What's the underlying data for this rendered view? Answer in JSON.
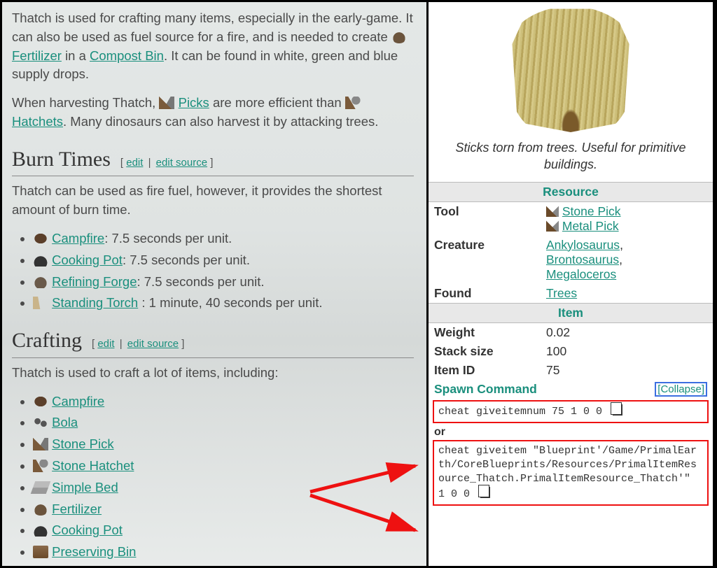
{
  "intro": {
    "p1a": "Thatch is used for crafting many items, especially in the early-game. It can also be used as fuel source for a fire, and is needed to create ",
    "fertilizer": "Fertilizer",
    "p1b": " in a ",
    "compost_bin": "Compost Bin",
    "p1c": ". It can be found in white, green and blue supply drops.",
    "p2a": "When harvesting Thatch, ",
    "picks": "Picks",
    "p2b": " are more efficient than ",
    "hatchets": "Hatchets",
    "p2c": ". Many dinosaurs can also harvest it by attacking trees."
  },
  "sections": {
    "burn": {
      "title": "Burn Times",
      "edit": "edit",
      "edit_source": "edit source",
      "intro": "Thatch can be used as fire fuel, however, it provides the shortest amount of burn time.",
      "items": [
        {
          "name": "Campfire",
          "tail": ": 7.5 seconds per unit."
        },
        {
          "name": "Cooking Pot",
          "tail": ": 7.5 seconds per unit."
        },
        {
          "name": "Refining Forge",
          "tail": ": 7.5 seconds per unit."
        },
        {
          "name": "Standing Torch",
          "tail": " : 1 minute, 40 seconds per unit."
        }
      ]
    },
    "craft": {
      "title": "Crafting",
      "edit": "edit",
      "edit_source": "edit source",
      "intro": "Thatch is used to craft a lot of items, including:",
      "items": [
        "Campfire",
        "Bola",
        "Stone Pick",
        "Stone Hatchet",
        "Simple Bed",
        "Fertilizer",
        "Cooking Pot",
        "Preserving Bin"
      ]
    }
  },
  "info": {
    "caption": "Sticks torn from trees. Useful for primitive buildings.",
    "resource_head": "Resource",
    "item_head": "Item",
    "rows": {
      "tool_k": "Tool",
      "tool_v1": "Stone Pick",
      "tool_v2": "Metal Pick",
      "creature_k": "Creature",
      "creature_v1": "Ankylosaurus",
      "creature_v2": "Brontosaurus",
      "creature_v3": "Megaloceros",
      "found_k": "Found",
      "found_v": "Trees",
      "weight_k": "Weight",
      "weight_v": "0.02",
      "stack_k": "Stack size",
      "stack_v": "100",
      "id_k": "Item ID",
      "id_v": "75",
      "spawn_k": "Spawn Command",
      "collapse": "Collapse",
      "cmd1": "cheat giveitemnum 75 1 0 0",
      "or": "or",
      "cmd2": "cheat giveitem \"Blueprint'/Game/PrimalEarth/CoreBlueprints/Resources/PrimalItemResource_Thatch.PrimalItemResource_Thatch'\" 1 0 0"
    }
  }
}
